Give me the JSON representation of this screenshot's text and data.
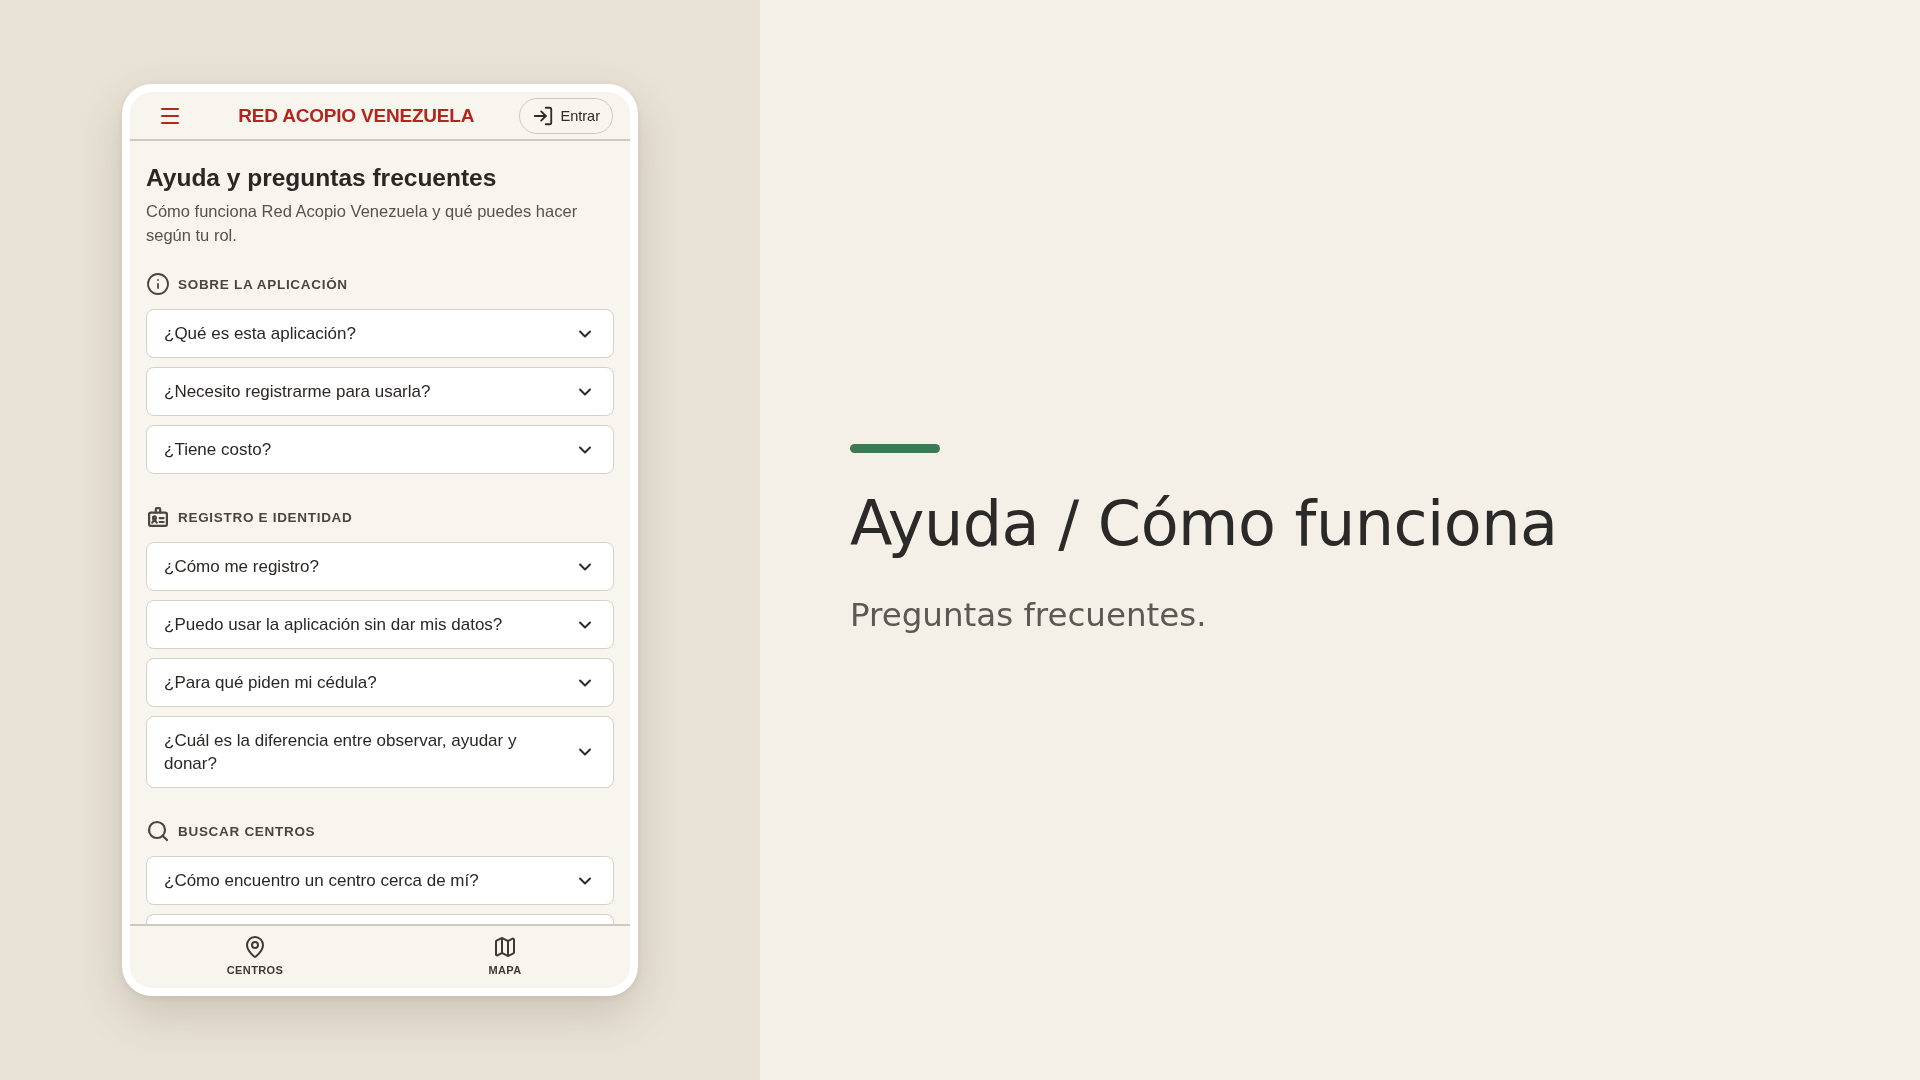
{
  "app_header": {
    "brand": "RED ACOPIO VENEZUELA",
    "login_button": "Entrar"
  },
  "page": {
    "title": "Ayuda y preguntas frecuentes",
    "description": "Cómo funciona Red Acopio Venezuela y qué puedes hacer según tu rol."
  },
  "sections": [
    {
      "heading": "SOBRE LA APLICACIÓN",
      "items": [
        {
          "kind": "question",
          "question": "¿Qué es esta aplicación?",
          "expanded": false
        },
        {
          "kind": "question",
          "question": "¿Necesito registrarme para usarla?",
          "expanded": false
        },
        {
          "kind": "question",
          "question": "¿Tiene costo?",
          "expanded": false
        }
      ]
    },
    {
      "heading": "REGISTRO E IDENTIDAD",
      "items": [
        {
          "kind": "question",
          "question": "¿Cómo me registro?",
          "expanded": false
        },
        {
          "kind": "question",
          "question": "¿Puedo usar la aplicación sin dar mis datos?",
          "expanded": false
        },
        {
          "kind": "question",
          "question": "¿Para qué piden mi cédula?",
          "expanded": false
        },
        {
          "kind": "question",
          "question": "¿Cuál es la diferencia entre observar, ayudar y donar?",
          "expanded": false
        }
      ]
    },
    {
      "heading": "BUSCAR CENTROS",
      "items": [
        {
          "kind": "question",
          "question": "¿Cómo encuentro un centro cerca de mí?",
          "expanded": false
        },
        {
          "kind": "clipped"
        }
      ]
    }
  ],
  "bottom_nav": [
    {
      "label": "CENTROS",
      "selected": false
    },
    {
      "label": "MAPA",
      "selected": false
    }
  ],
  "hero": {
    "title": "Ayuda / Cómo funciona",
    "subtitle": "Preguntas frecuentes."
  }
}
